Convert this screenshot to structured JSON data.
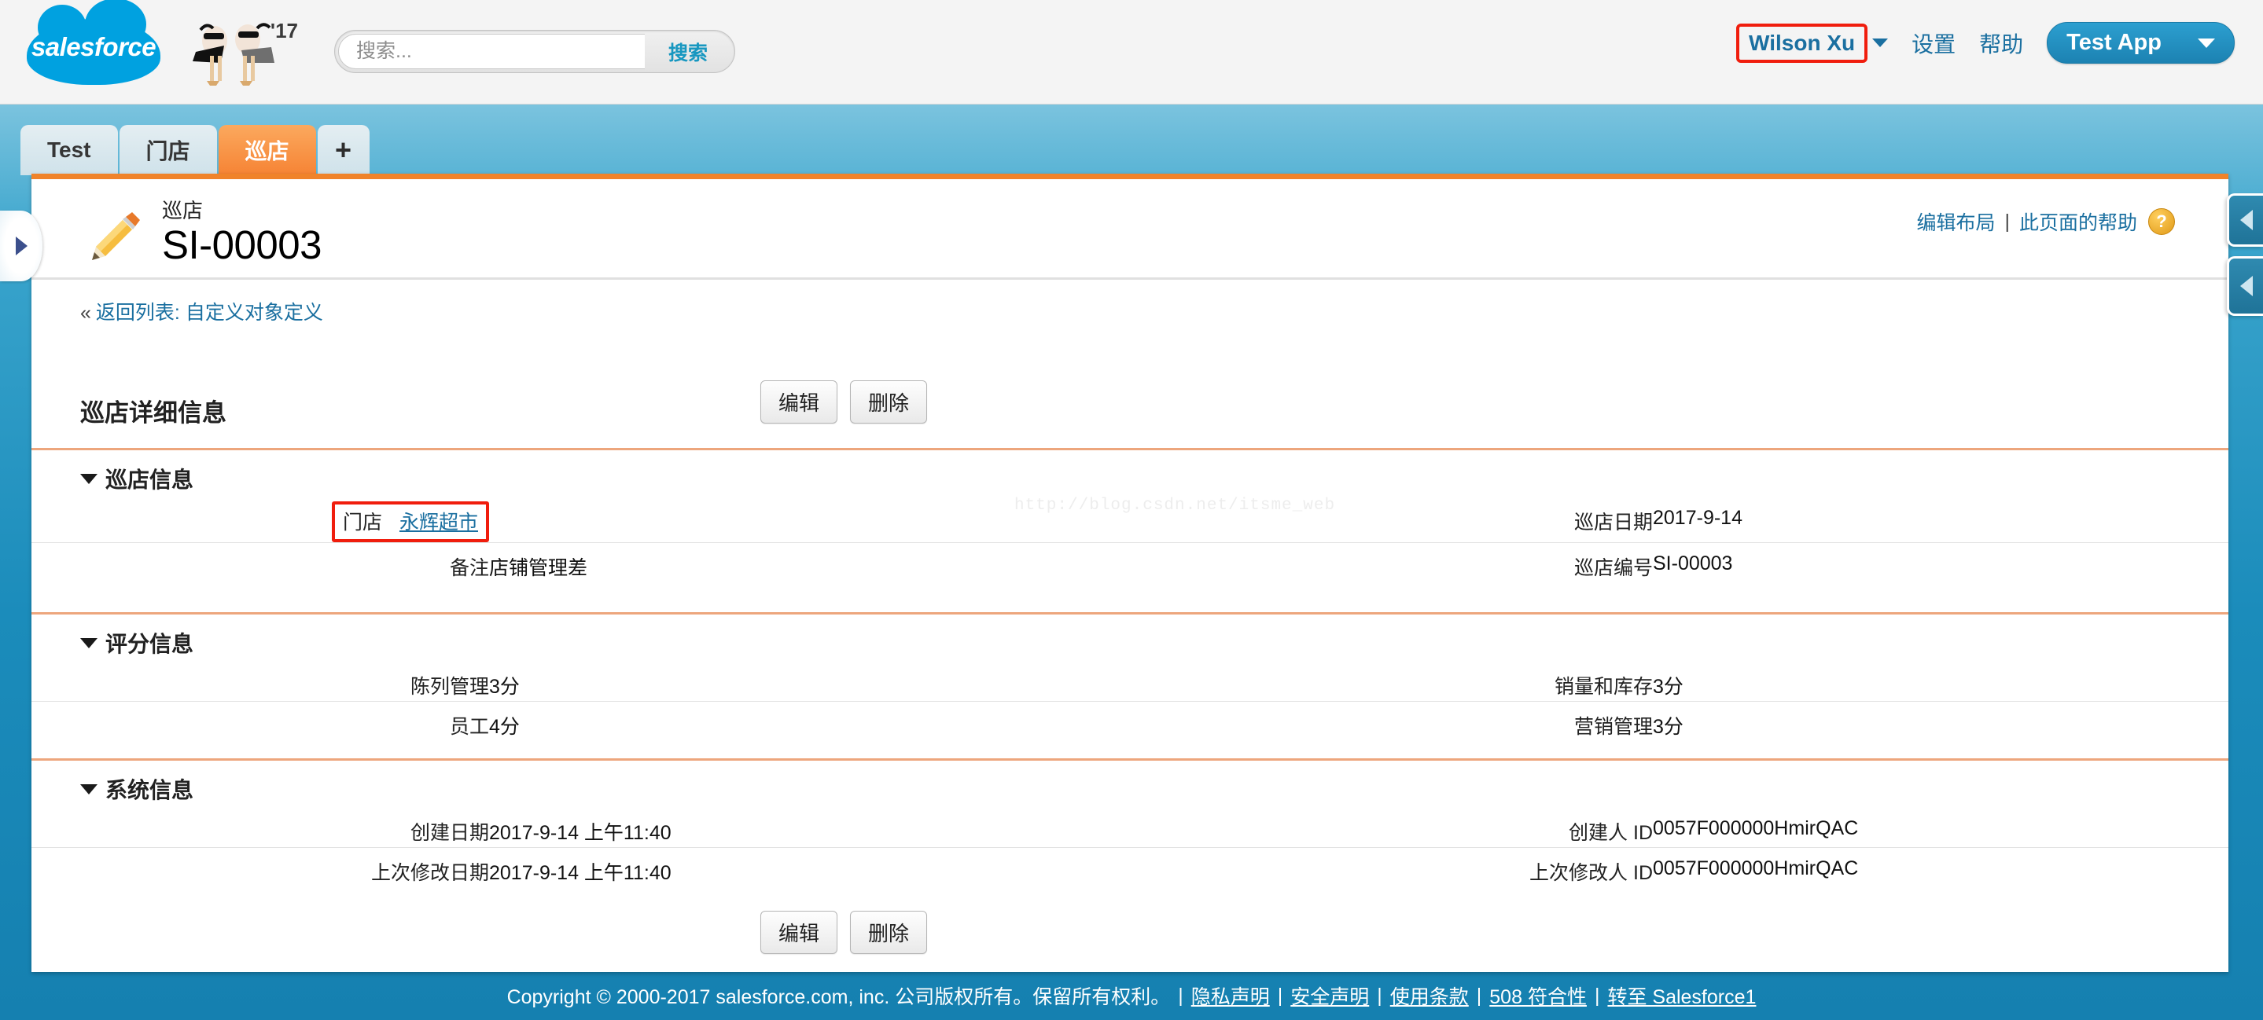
{
  "header": {
    "logo_text": "salesforce",
    "mascot_year": "'17",
    "search": {
      "placeholder": "搜索...",
      "value": "",
      "button_label": "搜索"
    },
    "user_name": "Wilson Xu",
    "settings_label": "设置",
    "help_label": "帮助",
    "app_label": "Test App",
    "accent_blue": "#00a1e0",
    "highlight_red": "#f01d0d"
  },
  "tabs": {
    "items": [
      {
        "label": "Test",
        "active": false
      },
      {
        "label": "门店",
        "active": false
      },
      {
        "label": "巡店",
        "active": true
      }
    ],
    "add_label": "+",
    "active_color": "#f68334"
  },
  "record": {
    "object_label": "巡店",
    "name": "SI-00003",
    "edit_layout_label": "编辑布局",
    "separator": "|",
    "page_help_label": "此页面的帮助",
    "help_icon_glyph": "?",
    "back_chevron": "«",
    "back_prefix": "返回列表:",
    "back_link": "自定义对象定义"
  },
  "detail": {
    "title": "巡店详细信息",
    "edit_label": "编辑",
    "delete_label": "删除",
    "sections": [
      {
        "title": "巡店信息",
        "rows": [
          {
            "left_label": "门店",
            "left_value": "永辉超市",
            "left_is_link": true,
            "left_highlighted": true,
            "right_label": "巡店日期",
            "right_value": "2017-9-14"
          },
          {
            "left_label": "备注",
            "left_value": "店铺管理差",
            "left_is_link": false,
            "left_highlighted": false,
            "right_label": "巡店编号",
            "right_value": "SI-00003"
          }
        ]
      },
      {
        "title": "评分信息",
        "rows": [
          {
            "left_label": "陈列管理",
            "left_value": "3分",
            "left_is_link": false,
            "left_highlighted": false,
            "right_label": "销量和库存",
            "right_value": "3分"
          },
          {
            "left_label": "员工",
            "left_value": "4分",
            "left_is_link": false,
            "left_highlighted": false,
            "right_label": "营销管理",
            "right_value": "3分"
          }
        ]
      },
      {
        "title": "系统信息",
        "rows": [
          {
            "left_label": "创建日期",
            "left_value": "2017-9-14 上午11:40",
            "left_is_link": false,
            "left_highlighted": false,
            "right_label": "创建人 ID",
            "right_value": "0057F000000HmirQAC"
          },
          {
            "left_label": "上次修改日期",
            "left_value": "2017-9-14 上午11:40",
            "left_is_link": false,
            "left_highlighted": false,
            "right_label": "上次修改人 ID",
            "right_value": "0057F000000HmirQAC"
          }
        ]
      }
    ]
  },
  "watermark": "http://blog.csdn.net/itsme_web",
  "footer": {
    "copyright": "Copyright © 2000-2017 salesforce.com, inc. 公司版权所有。保留所有权利。",
    "links": [
      "隐私声明",
      "安全声明",
      "使用条款",
      "508 符合性",
      "转至 Salesforce1"
    ]
  }
}
